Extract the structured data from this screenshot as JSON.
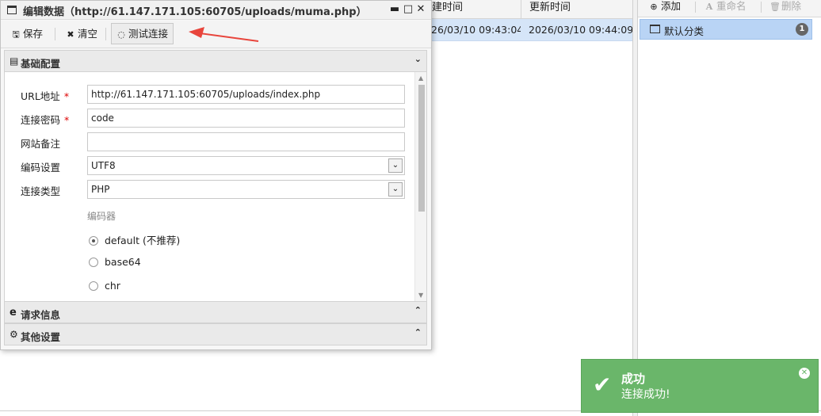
{
  "table": {
    "columns": {
      "created": "建时间",
      "updated": "更新时间"
    },
    "row": {
      "created": "26/03/10 09:43:04",
      "updated": "2026/03/10 09:44:09"
    }
  },
  "category_panel": {
    "toolbar": {
      "add": "添加",
      "rename": "重命名",
      "delete": "删除"
    },
    "item": {
      "label": "默认分类",
      "count": "1"
    }
  },
  "dialog": {
    "title": "编辑数据（http://61.147.171.105:60705/uploads/muma.php）",
    "toolbar": {
      "save": "保存",
      "clear": "清空",
      "test": "测试连接"
    },
    "sections": {
      "basic": "基础配置",
      "request": "请求信息",
      "other": "其他设置"
    },
    "form": {
      "url_label": "URL地址",
      "url_value": "http://61.147.171.105:60705/uploads/index.php",
      "password_label": "连接密码",
      "password_value": "code",
      "note_label": "网站备注",
      "note_value": "",
      "encoding_label": "编码设置",
      "encoding_value": "UTF8",
      "type_label": "连接类型",
      "type_value": "PHP",
      "encoder_group_label": "编码器",
      "encoders": [
        "default (不推荐)",
        "base64",
        "chr"
      ],
      "selected_encoder": "default (不推荐)",
      "required_mark": "*"
    }
  },
  "toast": {
    "title": "成功",
    "message": "连接成功!"
  },
  "colors": {
    "toast_bg": "#6ab66a",
    "selection_bg": "#d5e5f8",
    "arrow": "#e8453c"
  }
}
